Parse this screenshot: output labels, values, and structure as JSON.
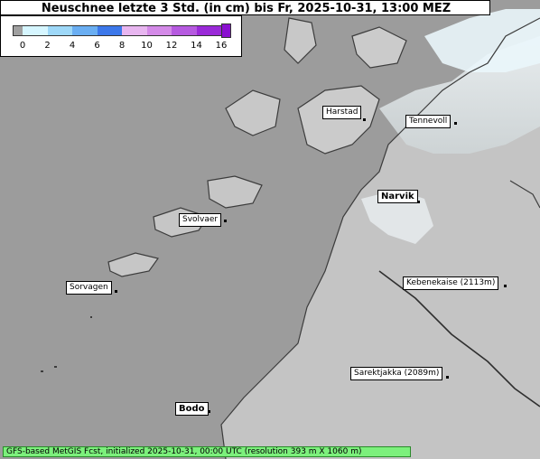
{
  "title": "Neuschnee letzte 3 Std. (in cm) bis Fr, 2025-10-31, 13:00 MEZ",
  "legend": {
    "ticks": [
      "0",
      "2",
      "4",
      "6",
      "8",
      "10",
      "12",
      "14",
      "16"
    ],
    "colors": [
      "#a0a0a0",
      "#d6f6ff",
      "#9ed8f8",
      "#6aaef2",
      "#3c78ea",
      "#e8b6f0",
      "#d48ae8",
      "#b65ae0",
      "#9a2ad8"
    ]
  },
  "places": [
    {
      "name": "Harstad",
      "bold": false
    },
    {
      "name": "Tennevoll",
      "bold": false
    },
    {
      "name": "Narvik",
      "bold": true
    },
    {
      "name": "Svolvaer",
      "bold": false
    },
    {
      "name": "Sorvagen",
      "bold": false
    },
    {
      "name": "Kebenekaise (2113m)",
      "bold": false
    },
    {
      "name": "Sarektjakka (2089m)",
      "bold": false
    },
    {
      "name": "Bodo",
      "bold": true
    }
  ],
  "footer": "GFS-based MetGIS Fcst, initialized 2025-10-31, 00:00 UTC  (resolution 393 m X 1060 m)"
}
